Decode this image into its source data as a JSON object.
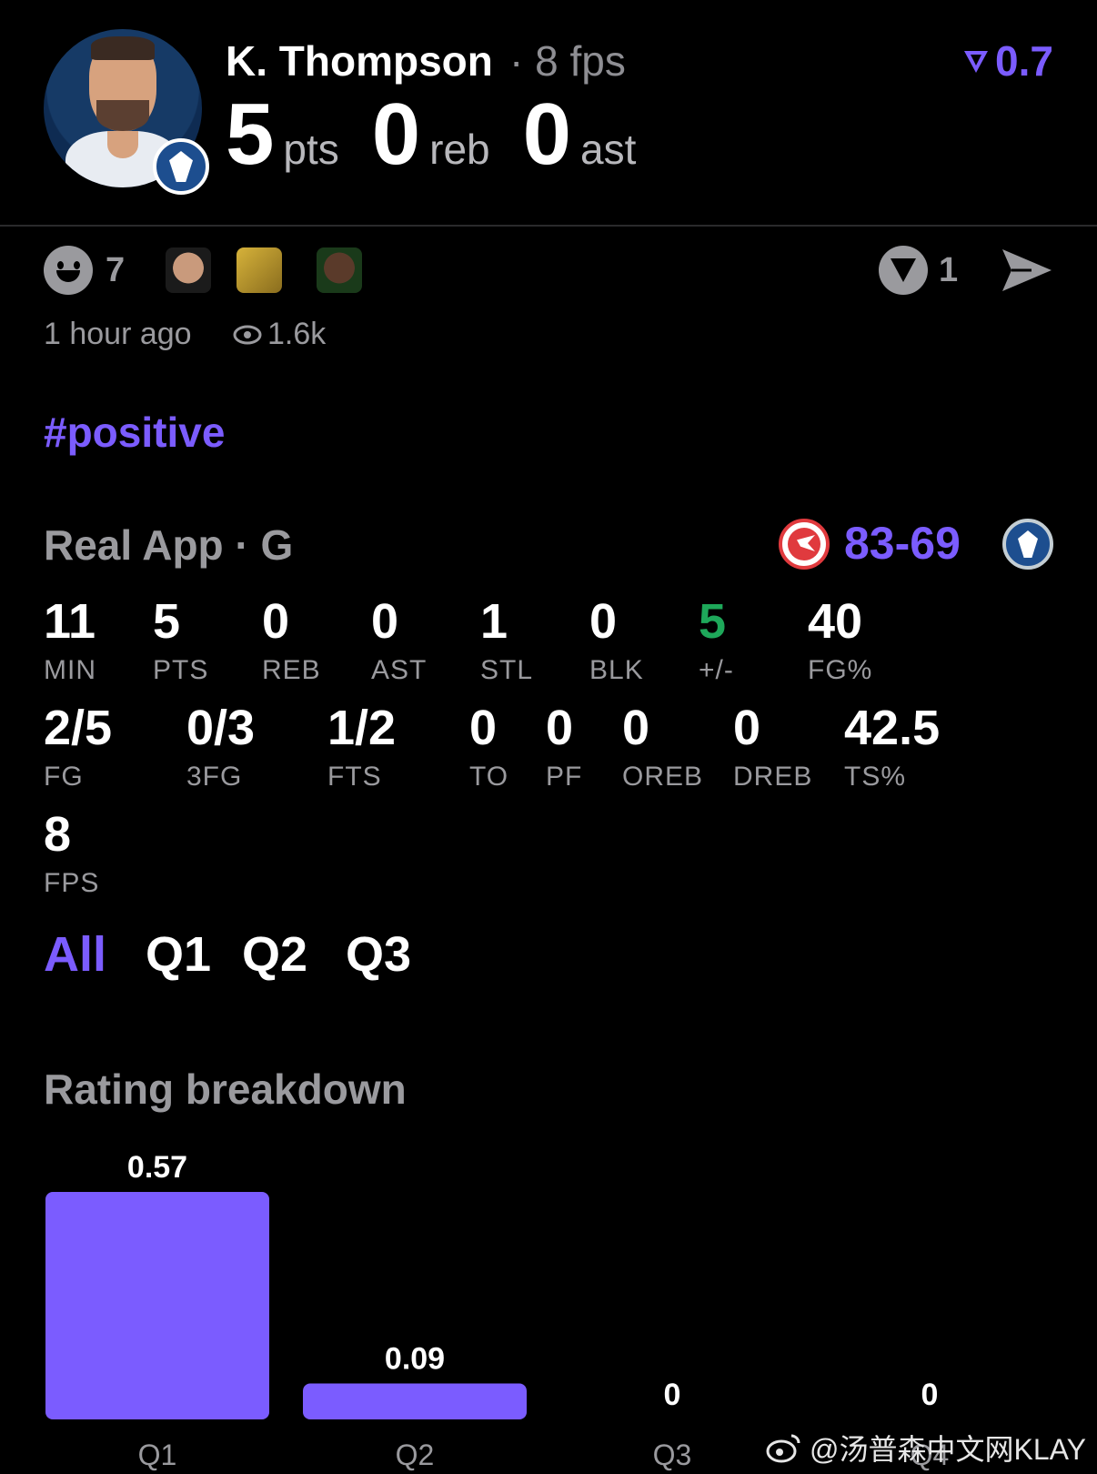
{
  "header": {
    "player_name": "K. Thompson",
    "player_fps": "· 8 fps",
    "rating": "0.7",
    "statline": [
      {
        "value": "5",
        "unit": "pts"
      },
      {
        "value": "0",
        "unit": "reb"
      },
      {
        "value": "0",
        "unit": "ast"
      }
    ]
  },
  "reactions": {
    "count": "7",
    "votes": "1",
    "time_ago": "1 hour ago",
    "views": "1.6k"
  },
  "hashtag": "#positive",
  "game": {
    "title": "Real App · G",
    "score": "83-69"
  },
  "stats_row1": [
    {
      "value": "11",
      "label": "MIN"
    },
    {
      "value": "5",
      "label": "PTS"
    },
    {
      "value": "0",
      "label": "REB"
    },
    {
      "value": "0",
      "label": "AST"
    },
    {
      "value": "1",
      "label": "STL"
    },
    {
      "value": "0",
      "label": "BLK"
    },
    {
      "value": "5",
      "label": "+/-"
    },
    {
      "value": "40",
      "label": "FG%"
    }
  ],
  "stats_row2": [
    {
      "value": "2/5",
      "label": "FG"
    },
    {
      "value": "0/3",
      "label": "3FG"
    },
    {
      "value": "1/2",
      "label": "FTS"
    },
    {
      "value": "0",
      "label": "TO"
    },
    {
      "value": "0",
      "label": "PF"
    },
    {
      "value": "0",
      "label": "OREB"
    },
    {
      "value": "0",
      "label": "DREB"
    },
    {
      "value": "42.5",
      "label": "TS%"
    }
  ],
  "stats_row3": [
    {
      "value": "8",
      "label": "FPS"
    }
  ],
  "tabs": [
    "All",
    "Q1",
    "Q2",
    "Q3"
  ],
  "breakdown_title": "Rating breakdown",
  "chart_data": {
    "type": "bar",
    "title": "Rating breakdown",
    "categories": [
      "Q1",
      "Q2",
      "Q3",
      "Q4"
    ],
    "values": [
      0.57,
      0.09,
      0,
      0
    ],
    "value_labels": [
      "0.57",
      "0.09",
      "0",
      "0"
    ],
    "ylim": [
      0,
      0.57
    ],
    "grid": false
  },
  "watermark": "@汤普森中文网KLAY",
  "colors": {
    "accent": "#7b5cff",
    "positive": "#1ea85a",
    "muted": "#9a9a9e",
    "background": "#000000"
  },
  "icons": [
    "rating-triangle-icon",
    "smile-icon",
    "vote-icon",
    "send-icon",
    "eye-icon",
    "weibo-icon"
  ]
}
